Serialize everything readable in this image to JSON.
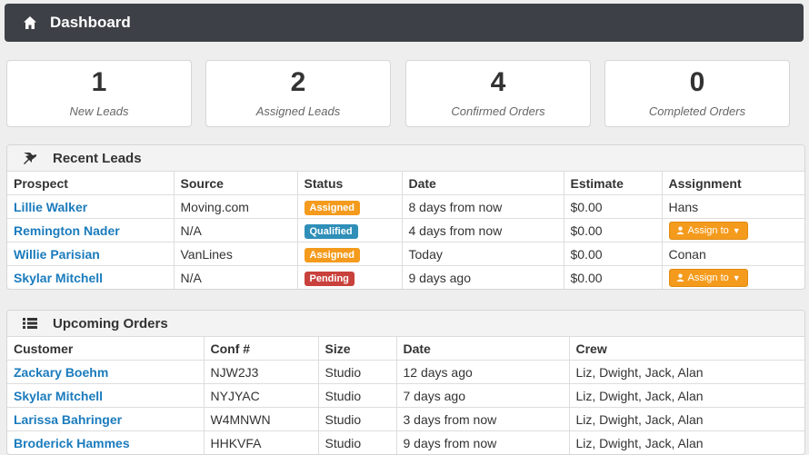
{
  "header": {
    "title": "Dashboard",
    "icon": "home-icon"
  },
  "stats": [
    {
      "value": "1",
      "label": "New Leads"
    },
    {
      "value": "2",
      "label": "Assigned Leads"
    },
    {
      "value": "4",
      "label": "Confirmed Orders"
    },
    {
      "value": "0",
      "label": "Completed Orders"
    }
  ],
  "recent_leads": {
    "title": "Recent Leads",
    "icon": "pushpin-icon",
    "columns": [
      "Prospect",
      "Source",
      "Status",
      "Date",
      "Estimate",
      "Assignment"
    ],
    "assign_label": "Assign to",
    "rows": [
      {
        "prospect": "Lillie Walker",
        "source": "Moving.com",
        "status": "Assigned",
        "status_color": "#f49b1d",
        "date": "8 days from now",
        "estimate": "$0.00",
        "assignment": "Hans"
      },
      {
        "prospect": "Remington Nader",
        "source": "N/A",
        "status": "Qualified",
        "status_color": "#2f8fb8",
        "date": "4 days from now",
        "estimate": "$0.00",
        "assignment": ""
      },
      {
        "prospect": "Willie Parisian",
        "source": "VanLines",
        "status": "Assigned",
        "status_color": "#f49b1d",
        "date": "Today",
        "estimate": "$0.00",
        "assignment": "Conan"
      },
      {
        "prospect": "Skylar Mitchell",
        "source": "N/A",
        "status": "Pending",
        "status_color": "#c9413c",
        "date": "9 days ago",
        "estimate": "$0.00",
        "assignment": ""
      }
    ]
  },
  "upcoming_orders": {
    "title": "Upcoming Orders",
    "icon": "list-icon",
    "columns": [
      "Customer",
      "Conf #",
      "Size",
      "Date",
      "Crew"
    ],
    "rows": [
      {
        "customer": "Zackary Boehm",
        "conf": "NJW2J3",
        "size": "Studio",
        "date": "12 days ago",
        "crew": "Liz, Dwight, Jack, Alan"
      },
      {
        "customer": "Skylar Mitchell",
        "conf": "NYJYAC",
        "size": "Studio",
        "date": "7 days ago",
        "crew": "Liz, Dwight, Jack, Alan"
      },
      {
        "customer": "Larissa Bahringer",
        "conf": "W4MNWN",
        "size": "Studio",
        "date": "3 days from now",
        "crew": "Liz, Dwight, Jack, Alan"
      },
      {
        "customer": "Broderick Hammes",
        "conf": "HHKVFA",
        "size": "Studio",
        "date": "9 days from now",
        "crew": "Liz, Dwight, Jack, Alan"
      }
    ]
  }
}
